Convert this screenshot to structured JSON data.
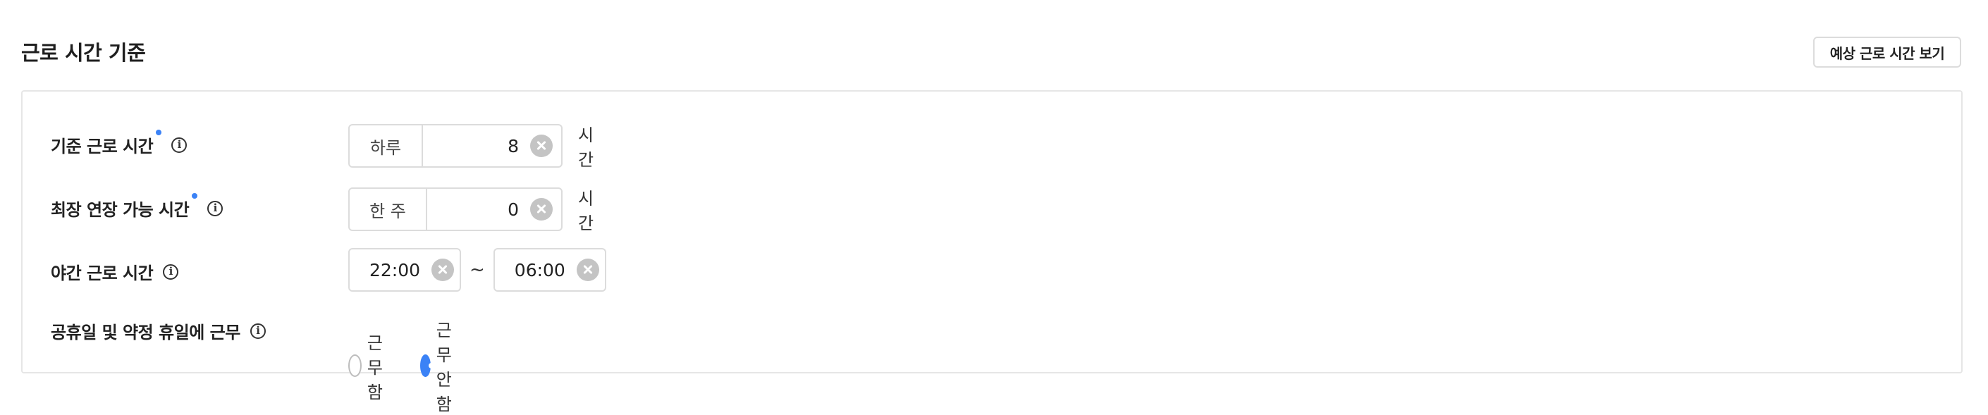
{
  "header": {
    "title": "근로 시간 기준",
    "preview_button": "예상 근로 시간 보기"
  },
  "rows": {
    "standard": {
      "label": "기준 근로 시간",
      "required": true,
      "prefix": "하루",
      "value": "8",
      "unit": "시간"
    },
    "max_extension": {
      "label": "최장 연장 가능 시간",
      "required": true,
      "prefix": "한 주",
      "value": "0",
      "unit": "시간"
    },
    "night": {
      "label": "야간 근로 시간",
      "start": "22:00",
      "separator": "~",
      "end": "06:00"
    },
    "holiday": {
      "label": "공휴일 및 약정 휴일에 근무",
      "options": [
        "근무함",
        "근무 안 함"
      ],
      "selected": "근무 안 함"
    }
  },
  "icons": {
    "info": "i",
    "accent_color": "#3b82f6"
  }
}
